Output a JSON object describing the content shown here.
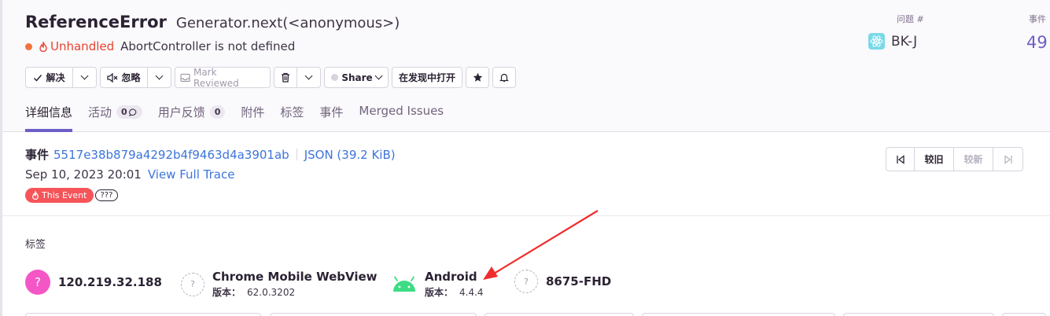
{
  "issue": {
    "title": "ReferenceError",
    "subtitle": "Generator.next(<anonymous>)",
    "status_label": "Unhandled",
    "message": "AbortController is not defined"
  },
  "toolbar": {
    "resolve_label": "解决",
    "ignore_label": "忽略",
    "mark_reviewed_label": "Mark Reviewed",
    "share_label": "Share",
    "open_discover_label": "在发现中打开"
  },
  "tabs": [
    {
      "label": "详细信息"
    },
    {
      "label": "活动",
      "count": "0"
    },
    {
      "label": "用户反馈",
      "count": "0"
    },
    {
      "label": "附件"
    },
    {
      "label": "标签"
    },
    {
      "label": "事件"
    },
    {
      "label": "Merged Issues"
    }
  ],
  "sidebar": {
    "issue_label": "问题 #",
    "issue_id": "BK-J",
    "events_label": "事件",
    "events_count": "49"
  },
  "event": {
    "label": "事件",
    "id": "5517e38b879a4292b4f9463d4a3901ab",
    "json_link": "JSON (39.2 KiB)",
    "date": "Sep 10, 2023 20:01",
    "view_trace": "View Full Trace",
    "this_event_badge": "This Event",
    "unknown_badge": "???"
  },
  "event_nav": {
    "older_label": "较旧",
    "newer_label": "较新"
  },
  "tags": {
    "title": "标签",
    "version_label": "版本：",
    "items": [
      {
        "name": "120.219.32.188"
      },
      {
        "name": "Chrome Mobile WebView",
        "version": "62.0.3202"
      },
      {
        "name": "Android",
        "version": "4.4.4"
      },
      {
        "name": "8675-FHD"
      }
    ]
  },
  "colors": {
    "accent": "#6c5fc7",
    "error": "#e8432f",
    "link": "#3d74db",
    "annotation_arrow": "#f02d2d"
  }
}
